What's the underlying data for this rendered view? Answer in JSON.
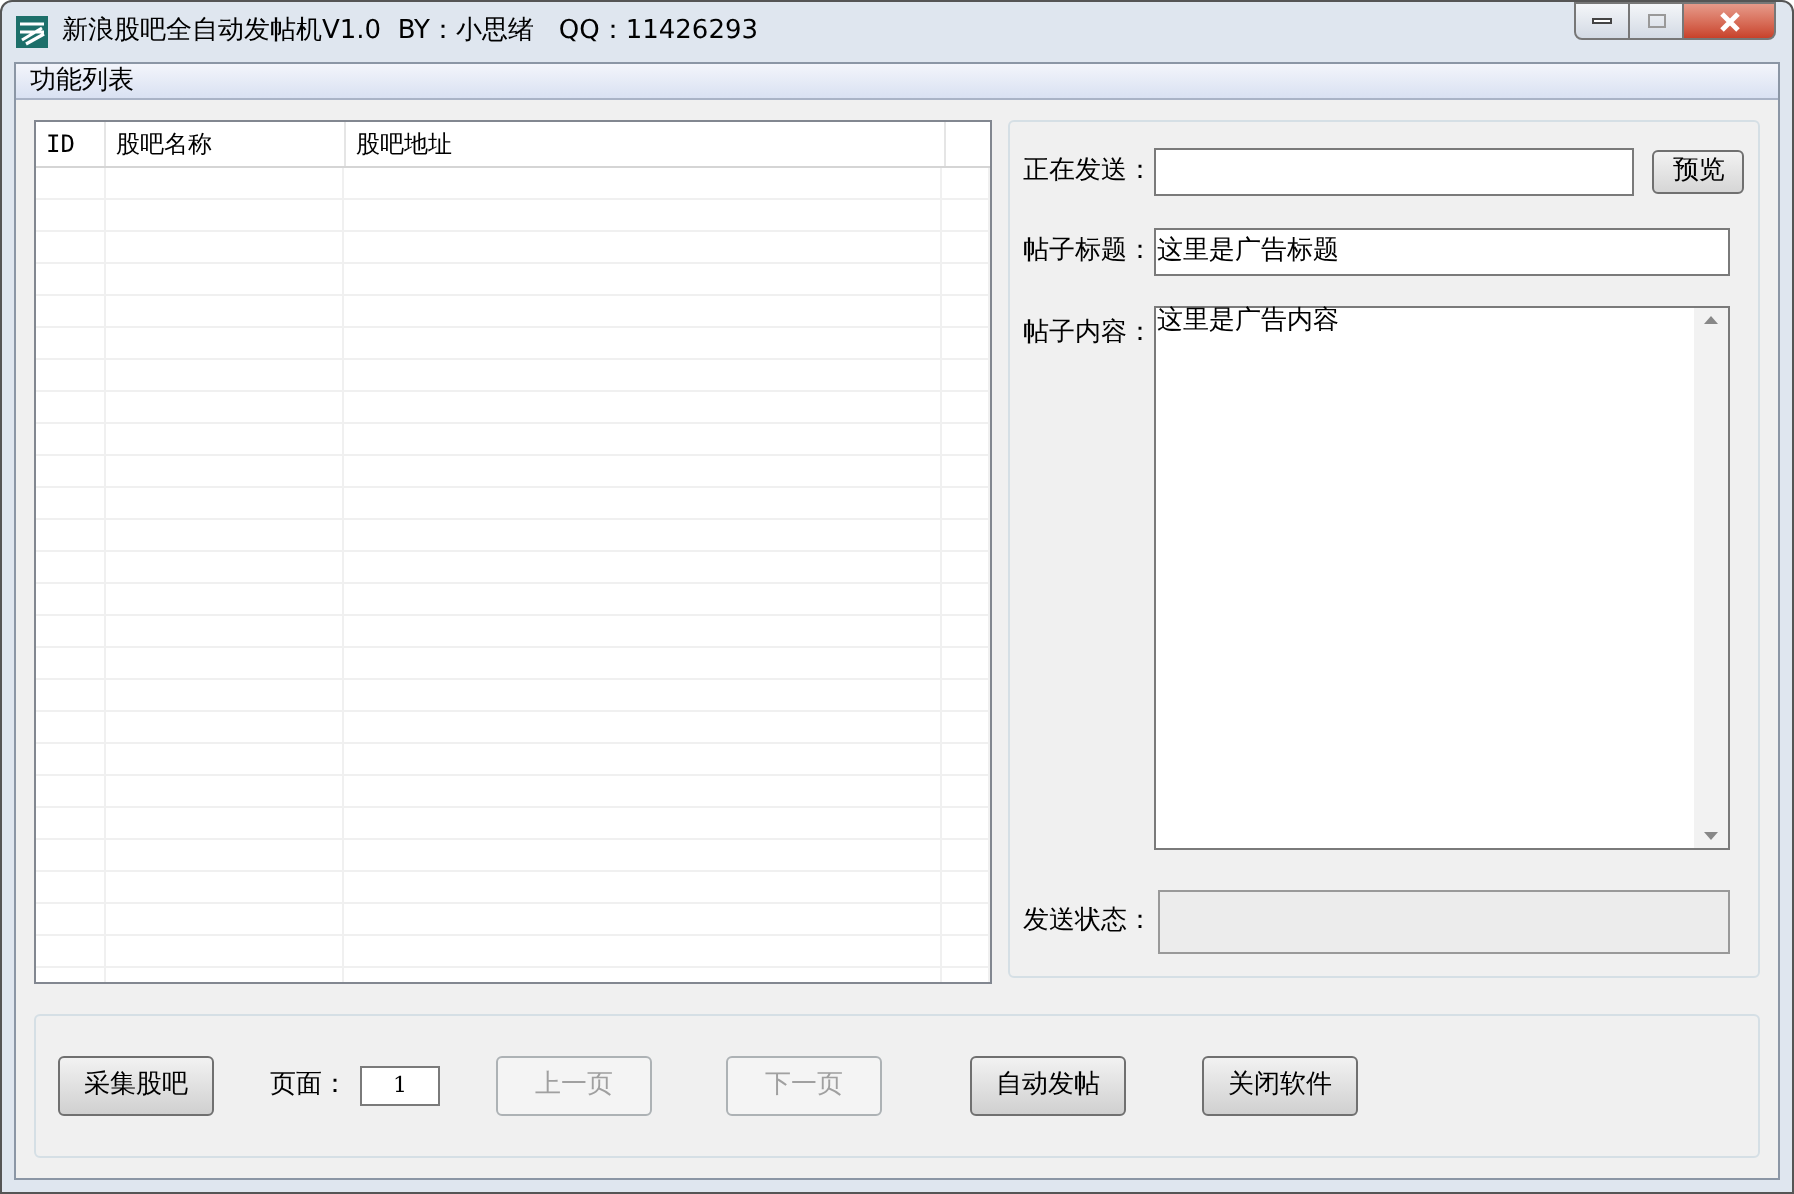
{
  "window": {
    "title": "新浪股吧全自动发帖机V1.0  BY：小思绪   QQ：11426293"
  },
  "menu_bar": {
    "items": [
      "功能列表"
    ]
  },
  "table": {
    "columns": [
      "ID",
      "股吧名称",
      "股吧地址"
    ]
  },
  "form": {
    "sending": {
      "label": "正在发送："
    },
    "preview_button": {
      "label": "预览",
      "disabled": false
    },
    "post_title": {
      "label": "帖子标题：",
      "value": "这里是广告标题"
    },
    "post_content": {
      "label": "帖子内容：",
      "value": "这里是广告内容"
    },
    "send_status": {
      "label": "发送状态："
    }
  },
  "toolbar": {
    "buttons": [
      {
        "kind": "button",
        "label": "采集股吧",
        "disabled": false
      },
      {
        "kind": "page",
        "label": "页面：",
        "value": "1"
      },
      {
        "kind": "button",
        "label": "上一页",
        "disabled": true
      },
      {
        "kind": "button",
        "label": "下一页",
        "disabled": true
      },
      {
        "kind": "button",
        "label": "自动发帖",
        "disabled": false
      },
      {
        "kind": "button",
        "label": "关闭软件",
        "disabled": false
      }
    ]
  }
}
